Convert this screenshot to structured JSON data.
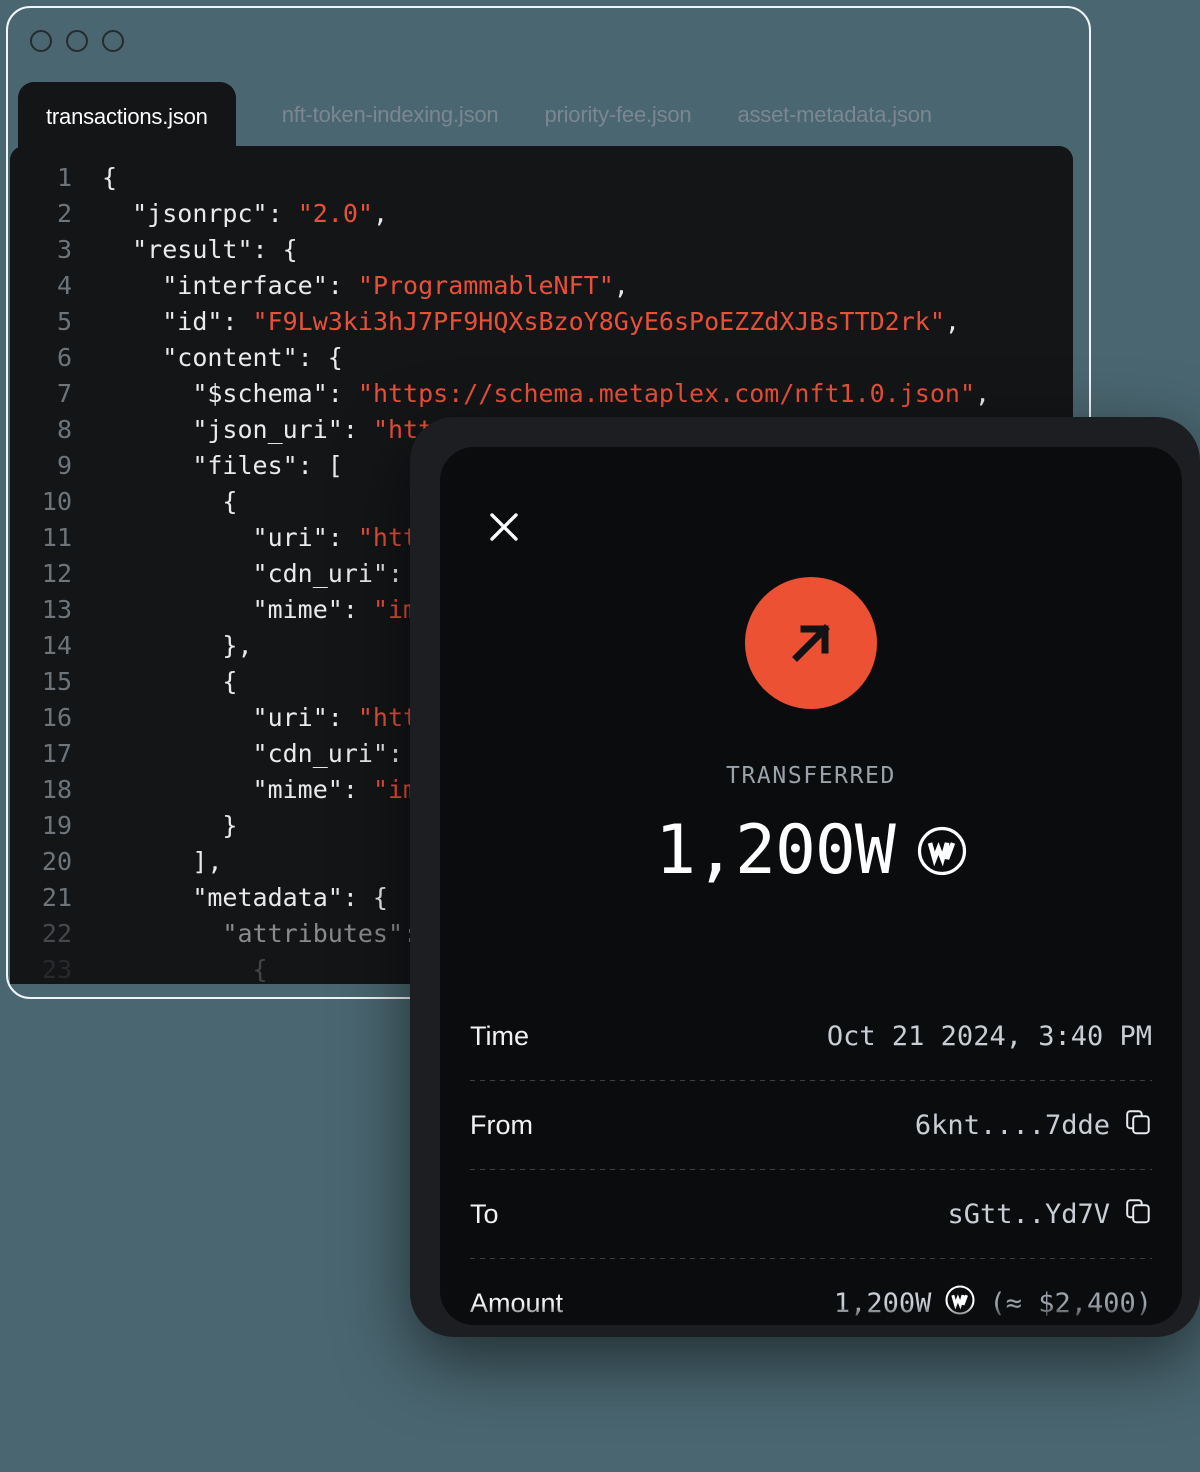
{
  "window": {
    "traffic_lights": [
      "close",
      "minimize",
      "maximize"
    ],
    "tabs": [
      {
        "label": "transactions.json",
        "active": true
      },
      {
        "label": "nft-token-indexing.json",
        "active": false
      },
      {
        "label": "priority-fee.json",
        "active": false
      },
      {
        "label": "asset-metadata.json",
        "active": false
      }
    ]
  },
  "code": {
    "language": "json",
    "lines": [
      {
        "n": "1",
        "indent": 0,
        "segments": [
          {
            "t": "{",
            "c": "pl"
          }
        ]
      },
      {
        "n": "2",
        "indent": 1,
        "segments": [
          {
            "t": "\"jsonrpc\": ",
            "c": "pl"
          },
          {
            "t": "\"2.0\"",
            "c": "st"
          },
          {
            "t": ",",
            "c": "pl"
          }
        ]
      },
      {
        "n": "3",
        "indent": 1,
        "segments": [
          {
            "t": "\"result\": {",
            "c": "pl"
          }
        ]
      },
      {
        "n": "4",
        "indent": 2,
        "segments": [
          {
            "t": "\"interface\": ",
            "c": "pl"
          },
          {
            "t": "\"ProgrammableNFT\"",
            "c": "st"
          },
          {
            "t": ",",
            "c": "pl"
          }
        ]
      },
      {
        "n": "5",
        "indent": 2,
        "segments": [
          {
            "t": "\"id\": ",
            "c": "pl"
          },
          {
            "t": "\"F9Lw3ki3hJ7PF9HQXsBzoY8GyE6sPoEZZdXJBsTTD2rk\"",
            "c": "st"
          },
          {
            "t": ",",
            "c": "pl"
          }
        ]
      },
      {
        "n": "6",
        "indent": 2,
        "segments": [
          {
            "t": "\"content\": {",
            "c": "pl"
          }
        ]
      },
      {
        "n": "7",
        "indent": 3,
        "segments": [
          {
            "t": "\"$schema\": ",
            "c": "pl"
          },
          {
            "t": "\"https://schema.metaplex.com/nft1.0.json\"",
            "c": "st"
          },
          {
            "t": ",",
            "c": "pl"
          }
        ]
      },
      {
        "n": "8",
        "indent": 3,
        "segments": [
          {
            "t": "\"json_uri\": ",
            "c": "pl"
          },
          {
            "t": "\"http",
            "c": "st"
          }
        ]
      },
      {
        "n": "9",
        "indent": 3,
        "segments": [
          {
            "t": "\"files\": [",
            "c": "pl"
          }
        ]
      },
      {
        "n": "10",
        "indent": 4,
        "segments": [
          {
            "t": "{",
            "c": "pl"
          }
        ]
      },
      {
        "n": "11",
        "indent": 5,
        "segments": [
          {
            "t": "\"uri\": ",
            "c": "pl"
          },
          {
            "t": "\"htt",
            "c": "st"
          }
        ]
      },
      {
        "n": "12",
        "indent": 5,
        "segments": [
          {
            "t": "\"cdn_uri\": ",
            "c": "pl"
          }
        ]
      },
      {
        "n": "13",
        "indent": 5,
        "segments": [
          {
            "t": "\"mime\": ",
            "c": "pl"
          },
          {
            "t": "\"im",
            "c": "st"
          }
        ]
      },
      {
        "n": "14",
        "indent": 4,
        "segments": [
          {
            "t": "},",
            "c": "pl"
          }
        ]
      },
      {
        "n": "15",
        "indent": 4,
        "segments": [
          {
            "t": "{",
            "c": "pl"
          }
        ]
      },
      {
        "n": "16",
        "indent": 5,
        "segments": [
          {
            "t": "\"uri\": ",
            "c": "pl"
          },
          {
            "t": "\"htt",
            "c": "st"
          }
        ]
      },
      {
        "n": "17",
        "indent": 5,
        "segments": [
          {
            "t": "\"cdn_uri\": ",
            "c": "pl"
          }
        ]
      },
      {
        "n": "18",
        "indent": 5,
        "segments": [
          {
            "t": "\"mime\": ",
            "c": "pl"
          },
          {
            "t": "\"im",
            "c": "st"
          }
        ]
      },
      {
        "n": "19",
        "indent": 4,
        "segments": [
          {
            "t": "}",
            "c": "pl"
          }
        ]
      },
      {
        "n": "20",
        "indent": 3,
        "segments": [
          {
            "t": "],",
            "c": "pl"
          }
        ]
      },
      {
        "n": "21",
        "indent": 3,
        "segments": [
          {
            "t": "\"metadata\": {",
            "c": "pl"
          }
        ]
      },
      {
        "n": "22",
        "indent": 4,
        "segments": [
          {
            "t": "\"attributes\":",
            "c": "pl"
          }
        ]
      },
      {
        "n": "23",
        "indent": 5,
        "segments": [
          {
            "t": "{",
            "c": "pl"
          }
        ]
      }
    ]
  },
  "modal": {
    "close_icon": "close-icon",
    "hero_icon": "arrow-up-right-icon",
    "status": "TRANSFERRED",
    "amount": "1,200W",
    "token_logo": "w-token-icon",
    "details": [
      {
        "label": "Time",
        "value": "Oct 21 2024, 3:40 PM",
        "copy": false,
        "token": false,
        "usd": ""
      },
      {
        "label": "From",
        "value": "6knt....7dde",
        "copy": true,
        "token": false,
        "usd": ""
      },
      {
        "label": "To",
        "value": "sGtt..Yd7V",
        "copy": true,
        "token": false,
        "usd": ""
      },
      {
        "label": "Amount",
        "value": "1,200W",
        "copy": false,
        "token": true,
        "usd": "(≈ $2,400)"
      }
    ]
  },
  "colors": {
    "page_background": "#4a6670",
    "window_border": "#f2f5f6",
    "code_background": "#131517",
    "string_color": "#e8503a",
    "accent": "#ec5134",
    "card_background": "#0b0c0e",
    "bezel": "#1c1e21"
  }
}
